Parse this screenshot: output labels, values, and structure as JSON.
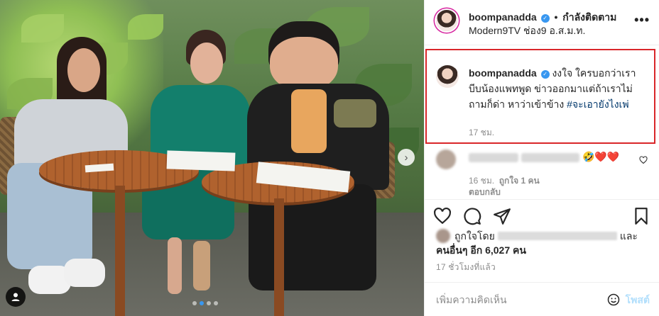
{
  "header": {
    "username": "boompanadda",
    "separator": "•",
    "follow_status": "กำลังติดตาม",
    "location": "Modern9TV ช่อง9 อ.ส.ม.ท.",
    "more_icon": "more-horizontal-icon"
  },
  "caption": {
    "username": "boompanadda",
    "text": "งงใจ ใครบอกว่าเราบีบน้องแพทพูด ข่าวออกมาแต่ถ้าเราไม่ถามก็ด่า หาว่าเข้าข้าง",
    "hashtag": "#จะเอายังไงเพ่",
    "time": "17 ชม.",
    "highlight_color": "#d9262a"
  },
  "comment": {
    "emojis": "🤣❤️❤️",
    "time": "16 ชม.",
    "likes": "ถูกใจ 1 คน",
    "reply": "ตอบกลับ"
  },
  "likes_line": {
    "prefix": "ถูกใจโดย",
    "and": "และ",
    "others": "คนอื่นๆ อีก 6,027 คน"
  },
  "time_ago": "17 ชั่วโมงที่แล้ว",
  "add_comment": {
    "placeholder": "เพิ่มความคิดเห็น",
    "post_label": "โพสต์"
  },
  "colors": {
    "link_blue": "#00376b",
    "verified_blue": "#3897f0",
    "secondary_text": "#8e8e8e",
    "post_disabled": "#b2dffc",
    "like_red": "#ed4956"
  },
  "carousel": {
    "slide_count": 4,
    "active_slide": 2,
    "next_icon": "chevron-right-icon"
  }
}
